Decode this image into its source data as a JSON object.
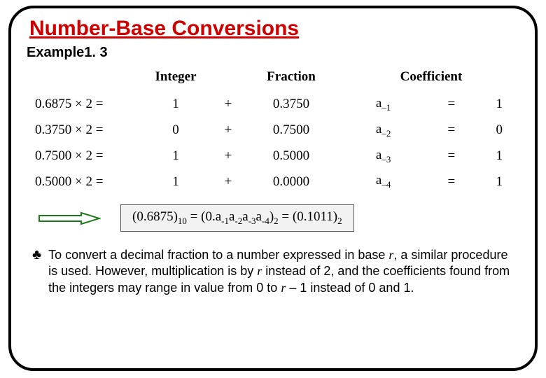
{
  "title": "Number-Base Conversions",
  "example_label": "Example1. 3",
  "headers": {
    "integer": "Integer",
    "fraction": "Fraction",
    "coefficient": "Coefficient"
  },
  "rows": [
    {
      "lhs": "0.6875 × 2 =",
      "int": "1",
      "plus": "+",
      "frac": "0.3750",
      "coef_a": "a",
      "coef_sub": "–1",
      "eq": "=",
      "coef_val": "1"
    },
    {
      "lhs": "0.3750 × 2 =",
      "int": "0",
      "plus": "+",
      "frac": "0.7500",
      "coef_a": "a",
      "coef_sub": "–2",
      "eq": "=",
      "coef_val": "0"
    },
    {
      "lhs": "0.7500 × 2 =",
      "int": "1",
      "plus": "+",
      "frac": "0.5000",
      "coef_a": "a",
      "coef_sub": "–3",
      "eq": "=",
      "coef_val": "1"
    },
    {
      "lhs": "0.5000 × 2 =",
      "int": "1",
      "plus": "+",
      "frac": "0.0000",
      "coef_a": "a",
      "coef_sub": "–4",
      "eq": "=",
      "coef_val": "1"
    }
  ],
  "result": {
    "prefix": "(0.6875)",
    "sub1": "10",
    "mid": " = (0.a",
    "a1s": "-1",
    "a2": "a",
    "a2s": "-2",
    "a3": "a",
    "a3s": "-3",
    "a4": "a",
    "a4s": "-4",
    "close1": ")",
    "sub2": "2",
    "eq2": " = (0.1011)",
    "sub3": "2"
  },
  "bullet": "♣",
  "note": {
    "t1": "To convert a decimal fraction to a number expressed in base ",
    "r1": "r",
    "t2": ", a similar procedure is used. However, multiplication is by ",
    "r2": "r",
    "t3": " instead of 2, and the coefficients found from the integers may range in value from 0 to ",
    "r3": "r",
    "t4": " – 1 instead of 0 and 1."
  }
}
